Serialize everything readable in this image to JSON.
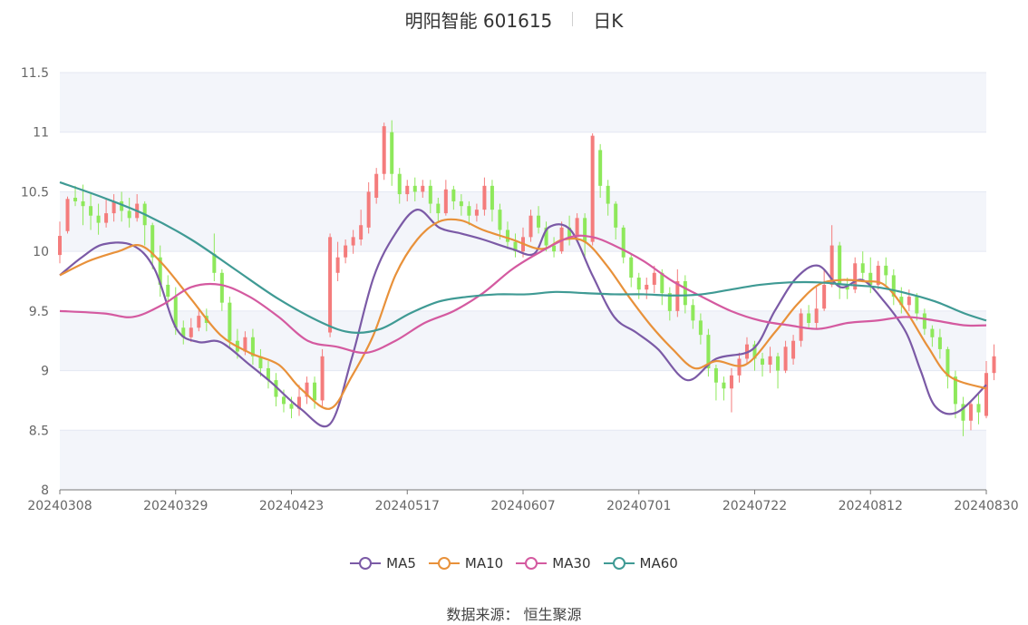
{
  "header": {
    "title": "明阳智能 601615",
    "period": "日K"
  },
  "source": {
    "label": "数据来源：",
    "value": "恒生聚源"
  },
  "colors": {
    "up": "#f47c7c",
    "down": "#8ee85b",
    "ma5": "#7b5aa6",
    "ma10": "#e8913a",
    "ma30": "#d45aa0",
    "ma60": "#3f9a94",
    "band": "#f3f5fa",
    "grid": "#e4e8f2",
    "axis": "#777777"
  },
  "chart_data": {
    "type": "candlestick",
    "title": "明阳智能 601615",
    "ylim": [
      8,
      11.5
    ],
    "y_ticks": [
      "8",
      "8.5",
      "9",
      "9.5",
      "10",
      "10.5",
      "11",
      "11.5"
    ],
    "x_tick_labels": [
      "20240308",
      "20240329",
      "20240423",
      "20240517",
      "20240607",
      "20240701",
      "20240722",
      "20240812",
      "20240830"
    ],
    "x_tick_index": [
      0,
      15,
      30,
      45,
      60,
      75,
      90,
      105,
      120
    ],
    "n_days": 121,
    "legend": [
      "MA5",
      "MA10",
      "MA30",
      "MA60"
    ],
    "ohlc": [
      [
        9.97,
        10.13,
        9.9,
        10.25
      ],
      [
        10.17,
        10.44,
        10.15,
        10.46
      ],
      [
        10.45,
        10.42,
        10.38,
        10.55
      ],
      [
        10.42,
        10.38,
        10.22,
        10.56
      ],
      [
        10.38,
        10.3,
        10.18,
        10.48
      ],
      [
        10.3,
        10.24,
        10.14,
        10.4
      ],
      [
        10.24,
        10.32,
        10.2,
        10.45
      ],
      [
        10.32,
        10.42,
        10.25,
        10.48
      ],
      [
        10.42,
        10.34,
        10.25,
        10.5
      ],
      [
        10.34,
        10.28,
        10.2,
        10.45
      ],
      [
        10.28,
        10.4,
        10.25,
        10.48
      ],
      [
        10.4,
        10.22,
        10.05,
        10.42
      ],
      [
        10.22,
        9.95,
        9.85,
        10.24
      ],
      [
        9.95,
        9.72,
        9.62,
        10.05
      ],
      [
        9.72,
        9.62,
        9.55,
        9.8
      ],
      [
        9.62,
        9.36,
        9.3,
        9.7
      ],
      [
        9.36,
        9.28,
        9.22,
        9.42
      ],
      [
        9.28,
        9.36,
        9.24,
        9.44
      ],
      [
        9.36,
        9.46,
        9.33,
        9.52
      ],
      [
        9.46,
        9.4,
        9.33,
        9.52
      ],
      [
        9.98,
        9.82,
        9.75,
        10.15
      ],
      [
        9.82,
        9.57,
        9.5,
        9.85
      ],
      [
        9.57,
        9.25,
        9.18,
        9.62
      ],
      [
        9.25,
        9.16,
        9.1,
        9.35
      ],
      [
        9.16,
        9.28,
        9.13,
        9.33
      ],
      [
        9.28,
        9.12,
        9.05,
        9.35
      ],
      [
        9.12,
        9.02,
        8.95,
        9.18
      ],
      [
        9.02,
        8.92,
        8.85,
        9.08
      ],
      [
        8.92,
        8.78,
        8.7,
        8.98
      ],
      [
        8.78,
        8.72,
        8.65,
        8.84
      ],
      [
        8.72,
        8.68,
        8.6,
        8.78
      ],
      [
        8.68,
        8.78,
        8.62,
        8.88
      ],
      [
        8.78,
        8.9,
        8.72,
        8.95
      ],
      [
        8.9,
        8.75,
        8.68,
        8.95
      ],
      [
        8.75,
        9.12,
        8.7,
        9.18
      ],
      [
        9.32,
        10.12,
        9.28,
        10.15
      ],
      [
        9.82,
        9.95,
        9.75,
        10.08
      ],
      [
        9.95,
        10.05,
        9.9,
        10.1
      ],
      [
        10.05,
        10.12,
        9.98,
        10.18
      ],
      [
        10.1,
        10.22,
        10.05,
        10.35
      ],
      [
        10.2,
        10.5,
        10.15,
        10.58
      ],
      [
        10.45,
        10.65,
        10.4,
        10.7
      ],
      [
        10.65,
        11.05,
        10.6,
        11.08
      ],
      [
        11.0,
        10.65,
        10.55,
        11.1
      ],
      [
        10.65,
        10.48,
        10.4,
        10.7
      ],
      [
        10.48,
        10.55,
        10.42,
        10.6
      ],
      [
        10.55,
        10.5,
        10.42,
        10.62
      ],
      [
        10.5,
        10.55,
        10.45,
        10.6
      ],
      [
        10.55,
        10.4,
        10.32,
        10.6
      ],
      [
        10.4,
        10.32,
        10.25,
        10.45
      ],
      [
        10.32,
        10.52,
        10.3,
        10.6
      ],
      [
        10.52,
        10.42,
        10.35,
        10.55
      ],
      [
        10.42,
        10.38,
        10.3,
        10.48
      ],
      [
        10.38,
        10.3,
        10.22,
        10.42
      ],
      [
        10.3,
        10.35,
        10.25,
        10.4
      ],
      [
        10.35,
        10.55,
        10.3,
        10.62
      ],
      [
        10.55,
        10.35,
        10.25,
        10.6
      ],
      [
        10.35,
        10.18,
        10.1,
        10.4
      ],
      [
        10.18,
        10.08,
        10.02,
        10.25
      ],
      [
        10.08,
        10.0,
        9.95,
        10.15
      ],
      [
        10.0,
        10.12,
        9.95,
        10.2
      ],
      [
        10.12,
        10.3,
        10.08,
        10.35
      ],
      [
        10.3,
        10.2,
        10.15,
        10.38
      ],
      [
        10.2,
        10.05,
        10.0,
        10.25
      ],
      [
        10.05,
        10.0,
        9.95,
        10.12
      ],
      [
        10.0,
        10.2,
        9.98,
        10.25
      ],
      [
        10.2,
        10.12,
        10.05,
        10.3
      ],
      [
        10.12,
        10.28,
        10.08,
        10.32
      ],
      [
        10.28,
        10.08,
        9.95,
        10.32
      ],
      [
        10.08,
        10.97,
        10.05,
        10.99
      ],
      [
        10.85,
        10.55,
        10.45,
        10.9
      ],
      [
        10.55,
        10.4,
        10.3,
        10.6
      ],
      [
        10.4,
        10.2,
        10.1,
        10.42
      ],
      [
        10.2,
        9.95,
        9.9,
        10.22
      ],
      [
        9.95,
        9.78,
        9.7,
        9.98
      ],
      [
        9.78,
        9.68,
        9.6,
        9.82
      ],
      [
        9.68,
        9.72,
        9.6,
        9.78
      ],
      [
        9.72,
        9.82,
        9.65,
        9.88
      ],
      [
        9.82,
        9.65,
        9.55,
        9.85
      ],
      [
        9.65,
        9.5,
        9.42,
        9.7
      ],
      [
        9.5,
        9.75,
        9.45,
        9.85
      ],
      [
        9.75,
        9.55,
        9.48,
        9.8
      ],
      [
        9.55,
        9.42,
        9.35,
        9.6
      ],
      [
        9.42,
        9.3,
        9.22,
        9.48
      ],
      [
        9.3,
        9.02,
        8.95,
        9.35
      ],
      [
        9.02,
        8.9,
        8.75,
        9.05
      ],
      [
        8.9,
        8.85,
        8.75,
        8.95
      ],
      [
        8.85,
        8.96,
        8.65,
        9.02
      ],
      [
        8.96,
        9.1,
        8.9,
        9.15
      ],
      [
        9.1,
        9.22,
        9.05,
        9.28
      ],
      [
        9.22,
        9.1,
        9.0,
        9.25
      ],
      [
        9.1,
        9.05,
        8.95,
        9.15
      ],
      [
        9.05,
        9.12,
        8.98,
        9.2
      ],
      [
        9.12,
        9.0,
        8.85,
        9.15
      ],
      [
        9.0,
        9.2,
        8.98,
        9.25
      ],
      [
        9.1,
        9.25,
        9.05,
        9.3
      ],
      [
        9.25,
        9.48,
        9.2,
        9.52
      ],
      [
        9.48,
        9.4,
        9.35,
        9.55
      ],
      [
        9.4,
        9.52,
        9.35,
        9.7
      ],
      [
        9.52,
        9.72,
        9.5,
        9.85
      ],
      [
        9.72,
        10.05,
        9.7,
        10.22
      ],
      [
        10.05,
        9.72,
        9.6,
        10.08
      ],
      [
        9.72,
        9.68,
        9.6,
        9.78
      ],
      [
        9.68,
        9.9,
        9.65,
        9.95
      ],
      [
        9.9,
        9.82,
        9.75,
        10.0
      ],
      [
        9.82,
        9.72,
        9.65,
        9.95
      ],
      [
        9.72,
        9.88,
        9.68,
        9.92
      ],
      [
        9.88,
        9.8,
        9.72,
        9.95
      ],
      [
        9.8,
        9.62,
        9.55,
        9.85
      ],
      [
        9.62,
        9.55,
        9.48,
        9.7
      ],
      [
        9.55,
        9.62,
        9.5,
        9.68
      ],
      [
        9.62,
        9.48,
        9.42,
        9.65
      ],
      [
        9.48,
        9.35,
        9.3,
        9.52
      ],
      [
        9.35,
        9.28,
        9.2,
        9.38
      ],
      [
        9.28,
        9.18,
        9.1,
        9.35
      ],
      [
        9.18,
        8.95,
        8.85,
        9.2
      ],
      [
        8.95,
        8.72,
        8.6,
        9.0
      ],
      [
        8.72,
        8.58,
        8.45,
        8.78
      ],
      [
        8.58,
        8.72,
        8.5,
        8.75
      ],
      [
        8.72,
        8.65,
        8.55,
        8.8
      ],
      [
        8.62,
        8.98,
        8.6,
        9.08
      ],
      [
        8.98,
        9.12,
        8.92,
        9.22
      ]
    ],
    "series": [
      {
        "name": "MA5",
        "points": [
          [
            0,
            9.8
          ],
          [
            3,
            9.95
          ],
          [
            6,
            10.06
          ],
          [
            10,
            10.05
          ],
          [
            13,
            9.85
          ],
          [
            16,
            9.35
          ],
          [
            19,
            9.24
          ],
          [
            22,
            9.24
          ],
          [
            26,
            9.05
          ],
          [
            29,
            8.9
          ],
          [
            33,
            8.68
          ],
          [
            37,
            8.55
          ],
          [
            40,
            9.1
          ],
          [
            43,
            9.78
          ],
          [
            46,
            10.15
          ],
          [
            49,
            10.35
          ],
          [
            52,
            10.2
          ],
          [
            55,
            10.15
          ],
          [
            58,
            10.1
          ],
          [
            62,
            10.02
          ],
          [
            65,
            9.98
          ],
          [
            67,
            10.2
          ],
          [
            70,
            10.18
          ],
          [
            73,
            9.8
          ],
          [
            76,
            9.45
          ],
          [
            79,
            9.32
          ],
          [
            82,
            9.18
          ],
          [
            86,
            8.92
          ],
          [
            90,
            9.1
          ],
          [
            95,
            9.18
          ],
          [
            98,
            9.5
          ],
          [
            101,
            9.78
          ],
          [
            104,
            9.88
          ],
          [
            107,
            9.7
          ],
          [
            110,
            9.76
          ],
          [
            113,
            9.58
          ],
          [
            116,
            9.32
          ],
          [
            118,
            9.0
          ],
          [
            120,
            8.7
          ],
          [
            123,
            8.65
          ],
          [
            127,
            8.88
          ]
        ]
      },
      {
        "name": "MA10",
        "points": [
          [
            0,
            9.8
          ],
          [
            4,
            9.92
          ],
          [
            8,
            10.0
          ],
          [
            11,
            10.05
          ],
          [
            14,
            9.9
          ],
          [
            18,
            9.6
          ],
          [
            22,
            9.3
          ],
          [
            26,
            9.15
          ],
          [
            30,
            9.05
          ],
          [
            33,
            8.85
          ],
          [
            37,
            8.68
          ],
          [
            40,
            8.95
          ],
          [
            43,
            9.3
          ],
          [
            46,
            9.8
          ],
          [
            49,
            10.1
          ],
          [
            52,
            10.25
          ],
          [
            55,
            10.26
          ],
          [
            58,
            10.18
          ],
          [
            62,
            10.1
          ],
          [
            66,
            10.02
          ],
          [
            69,
            10.1
          ],
          [
            72,
            10.08
          ],
          [
            75,
            9.88
          ],
          [
            78,
            9.62
          ],
          [
            81,
            9.38
          ],
          [
            84,
            9.18
          ],
          [
            87,
            9.02
          ],
          [
            90,
            9.08
          ],
          [
            94,
            9.05
          ],
          [
            98,
            9.32
          ],
          [
            101,
            9.55
          ],
          [
            104,
            9.72
          ],
          [
            107,
            9.76
          ],
          [
            110,
            9.75
          ],
          [
            113,
            9.72
          ],
          [
            116,
            9.5
          ],
          [
            119,
            9.2
          ],
          [
            122,
            8.95
          ],
          [
            127,
            8.85
          ]
        ]
      },
      {
        "name": "MA30",
        "points": [
          [
            0,
            9.5
          ],
          [
            6,
            9.48
          ],
          [
            10,
            9.45
          ],
          [
            14,
            9.55
          ],
          [
            18,
            9.7
          ],
          [
            22,
            9.72
          ],
          [
            26,
            9.62
          ],
          [
            30,
            9.45
          ],
          [
            34,
            9.25
          ],
          [
            38,
            9.2
          ],
          [
            42,
            9.15
          ],
          [
            46,
            9.25
          ],
          [
            50,
            9.4
          ],
          [
            54,
            9.5
          ],
          [
            58,
            9.65
          ],
          [
            62,
            9.85
          ],
          [
            66,
            10.0
          ],
          [
            70,
            10.12
          ],
          [
            73,
            10.12
          ],
          [
            76,
            10.05
          ],
          [
            80,
            9.92
          ],
          [
            84,
            9.75
          ],
          [
            88,
            9.62
          ],
          [
            92,
            9.5
          ],
          [
            96,
            9.42
          ],
          [
            100,
            9.38
          ],
          [
            104,
            9.35
          ],
          [
            108,
            9.4
          ],
          [
            112,
            9.42
          ],
          [
            116,
            9.45
          ],
          [
            120,
            9.42
          ],
          [
            124,
            9.38
          ],
          [
            127,
            9.38
          ]
        ]
      },
      {
        "name": "MA60",
        "points": [
          [
            0,
            10.58
          ],
          [
            6,
            10.45
          ],
          [
            12,
            10.3
          ],
          [
            18,
            10.1
          ],
          [
            24,
            9.85
          ],
          [
            30,
            9.6
          ],
          [
            36,
            9.4
          ],
          [
            40,
            9.32
          ],
          [
            44,
            9.35
          ],
          [
            48,
            9.48
          ],
          [
            52,
            9.58
          ],
          [
            56,
            9.62
          ],
          [
            60,
            9.64
          ],
          [
            64,
            9.64
          ],
          [
            68,
            9.66
          ],
          [
            72,
            9.65
          ],
          [
            76,
            9.64
          ],
          [
            80,
            9.64
          ],
          [
            84,
            9.63
          ],
          [
            88,
            9.64
          ],
          [
            92,
            9.68
          ],
          [
            96,
            9.72
          ],
          [
            100,
            9.74
          ],
          [
            104,
            9.74
          ],
          [
            108,
            9.72
          ],
          [
            112,
            9.7
          ],
          [
            116,
            9.65
          ],
          [
            120,
            9.58
          ],
          [
            124,
            9.48
          ],
          [
            127,
            9.42
          ]
        ]
      }
    ]
  }
}
